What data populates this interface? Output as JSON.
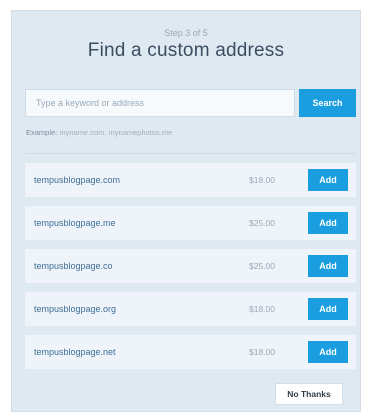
{
  "header": {
    "step": "Step 3 of 5",
    "title": "Find a custom address"
  },
  "search": {
    "placeholder": "Type a keyword or address",
    "value": "",
    "button_label": "Search",
    "example_label": "Example:",
    "example_text": " myname.com, mynamephotos.me"
  },
  "results": [
    {
      "domain": "tempusblogpage.com",
      "price": "$18.00",
      "button_label": "Add"
    },
    {
      "domain": "tempusblogpage.me",
      "price": "$25.00",
      "button_label": "Add"
    },
    {
      "domain": "tempusblogpage.co",
      "price": "$25.00",
      "button_label": "Add"
    },
    {
      "domain": "tempusblogpage.org",
      "price": "$18.00",
      "button_label": "Add"
    },
    {
      "domain": "tempusblogpage.net",
      "price": "$18.00",
      "button_label": "Add"
    }
  ],
  "footer": {
    "no_thanks_label": "No Thanks"
  },
  "colors": {
    "accent": "#1a9ee0",
    "panel_background": "#dfe9f2",
    "row_background": "#eef4f9",
    "domain_text": "#3e6f96"
  }
}
